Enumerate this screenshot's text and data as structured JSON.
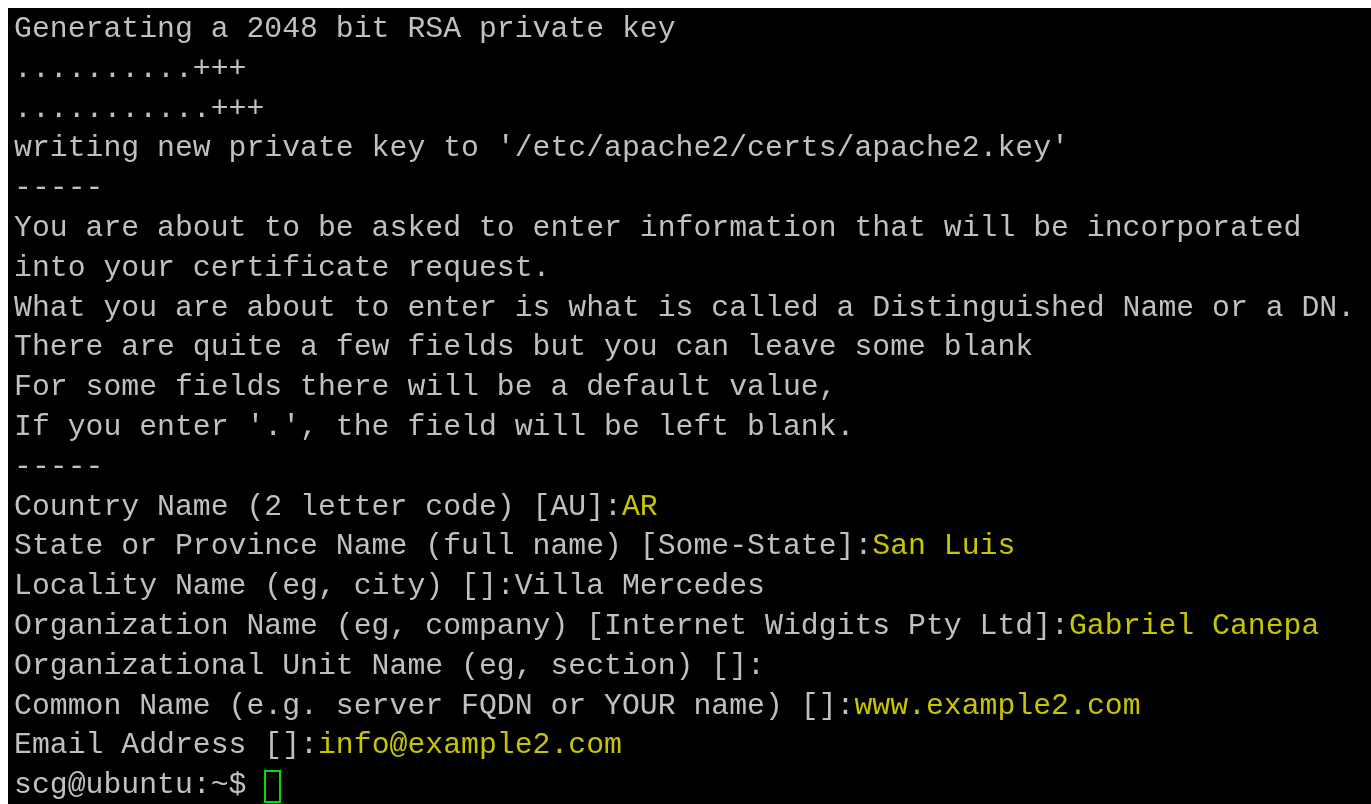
{
  "terminal": {
    "lines": [
      {
        "text": "Generating a 2048 bit RSA private key"
      },
      {
        "text": "..........+++"
      },
      {
        "text": "...........+++"
      },
      {
        "text": "writing new private key to '/etc/apache2/certs/apache2.key'"
      },
      {
        "text": "-----"
      },
      {
        "text": "You are about to be asked to enter information that will be incorporated"
      },
      {
        "text": "into your certificate request."
      },
      {
        "text": "What you are about to enter is what is called a Distinguished Name or a DN."
      },
      {
        "text": "There are quite a few fields but you can leave some blank"
      },
      {
        "text": "For some fields there will be a default value,"
      },
      {
        "text": "If you enter '.', the field will be left blank."
      },
      {
        "text": "-----"
      },
      {
        "text": "Country Name (2 letter code) [AU]:",
        "input": "AR"
      },
      {
        "text": "State or Province Name (full name) [Some-State]:",
        "input": "San Luis"
      },
      {
        "text": "Locality Name (eg, city) []:Villa Mercedes"
      },
      {
        "text": "Organization Name (eg, company) [Internet Widgits Pty Ltd]:",
        "input": "Gabriel Canepa"
      },
      {
        "text": "Organizational Unit Name (eg, section) []:"
      },
      {
        "text": "Common Name (e.g. server FQDN or YOUR name) []:",
        "input": "www.example2.com"
      },
      {
        "text": "Email Address []:",
        "input": "info@example2.com"
      }
    ],
    "prompt": "scg@ubuntu:~$"
  }
}
